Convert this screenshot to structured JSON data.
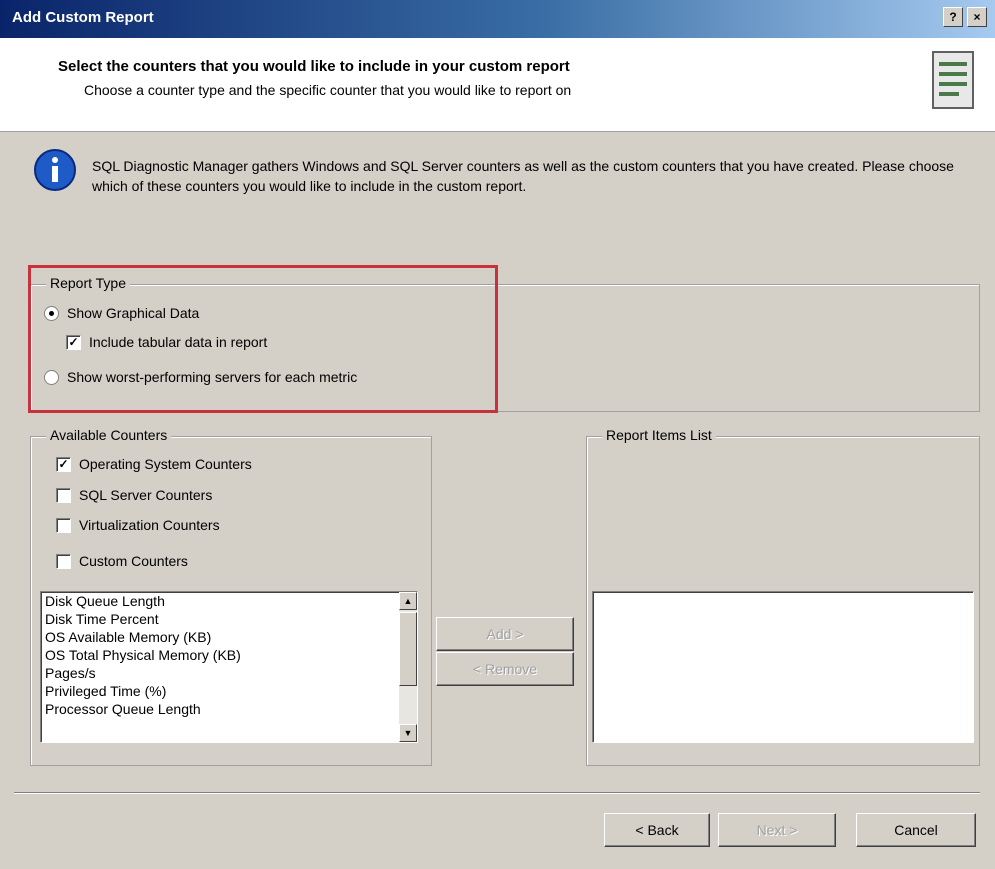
{
  "window": {
    "title": "Add Custom Report",
    "help_label": "?",
    "close_label": "×"
  },
  "header": {
    "title": "Select the counters that you would like to include in your custom report",
    "subtitle": "Choose a counter type and the specific counter that you would like to report on"
  },
  "info": {
    "text": "SQL Diagnostic Manager gathers Windows and SQL Server counters as well as the custom counters that you have created. Please choose which of these counters you would like to include in the custom report."
  },
  "report_type": {
    "legend": "Report Type",
    "options": [
      {
        "label": "Show Graphical Data",
        "selected": true
      },
      {
        "label": "Show worst-performing servers for each metric",
        "selected": false
      }
    ],
    "include_tabular": {
      "label": "Include tabular data in report",
      "checked": true
    }
  },
  "available_counters": {
    "legend": "Available Counters",
    "filters": [
      {
        "label": "Operating System Counters",
        "checked": true
      },
      {
        "label": "SQL Server Counters",
        "checked": false
      },
      {
        "label": "Virtualization Counters",
        "checked": false
      },
      {
        "label": "Custom Counters",
        "checked": false
      }
    ],
    "items": [
      "Disk Queue Length",
      "Disk Time Percent",
      "OS Available Memory (KB)",
      "OS Total Physical Memory (KB)",
      "Pages/s",
      "Privileged Time (%)",
      "Processor Queue Length"
    ]
  },
  "middle_buttons": {
    "add": "Add >",
    "remove": "< Remove"
  },
  "report_items": {
    "legend": "Report Items List"
  },
  "footer": {
    "back": "< Back",
    "next": "Next >",
    "cancel": "Cancel"
  },
  "colors": {
    "highlight": "#c8323c",
    "titlebar": "#0a246a"
  }
}
